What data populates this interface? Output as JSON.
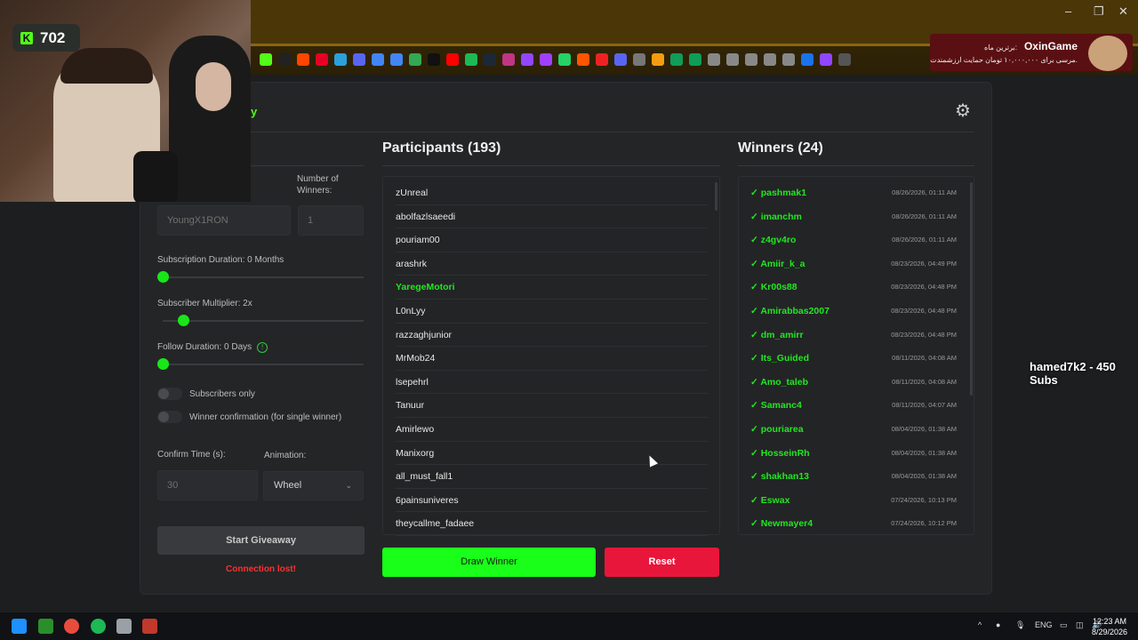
{
  "browser": {
    "bookmark_icons": [
      "kick-icon",
      "x-icon",
      "reddit-icon",
      "pinterest-icon",
      "telegram-icon",
      "download-icon",
      "translate-icon",
      "docs-icon",
      "image-icon",
      "film-icon",
      "youtube-icon",
      "spotify-icon",
      "steam-icon",
      "instagram-icon",
      "twitch-icon",
      "r-icon",
      "whatsapp-icon",
      "music-icon",
      "red-icon",
      "discord-icon",
      "controller-icon",
      "orange-icon",
      "plus-icon",
      "sheet-icon",
      "globe-icon",
      "link-icon",
      "flask-icon",
      "lock-icon",
      "moon-icon",
      "mail-icon",
      "purple-icon",
      "play-icon"
    ],
    "ad": {
      "name": "OxinGame",
      "line1": "برترین ماه:",
      "line2": "مرسی برای ۱۰,۰۰۰,۰۰۰ تومان حمایت ارزشمندت."
    }
  },
  "webcam": {
    "follower_count": "702"
  },
  "app": {
    "title_fragment": "y",
    "settings_icon": "gear-icon",
    "left": {
      "number_of_winners_label": "Number of Winners:",
      "keyword_placeholder": "YoungX1RON",
      "winners_placeholder": "1",
      "subscription_duration_label": "Subscription Duration: 0 Months",
      "subscription_duration_value": 0,
      "subscriber_multiplier_label": "Subscriber Multiplier: 2x",
      "subscriber_multiplier_value": 0.11,
      "follow_duration_label": "Follow Duration:  0  Days",
      "follow_duration_value": 0,
      "subscribers_only_label": "Subscribers only",
      "winner_confirmation_label": "Winner confirmation (for single winner)",
      "confirm_time_label": "Confirm Time (s):",
      "confirm_time_placeholder": "30",
      "animation_label": "Animation:",
      "animation_value": "Wheel",
      "start_button": "Start Giveaway",
      "connection_status": "Connection lost!"
    },
    "participants": {
      "heading": "Participants (193)",
      "items": [
        "zUnreal",
        "abolfazlsaeedi",
        "pouriam00",
        "arashrk",
        "YaregeMotori",
        "L0nLyy",
        "razzaghjunior",
        "MrMob24",
        "lsepehrl",
        "Tanuur",
        "Amirlewo",
        "Manixorg",
        "all_must_fall1",
        "6painsuniveres",
        "theycallme_fadaee"
      ],
      "highlighted_index": 4
    },
    "winners": {
      "heading": "Winners (24)",
      "items": [
        {
          "name": "pashmak1",
          "date": "08/26/2026, 01:11 AM"
        },
        {
          "name": "imanchm",
          "date": "08/26/2026, 01:11 AM"
        },
        {
          "name": "z4gv4ro",
          "date": "08/26/2026, 01:11 AM"
        },
        {
          "name": "Amiir_k_a",
          "date": "08/23/2026, 04:49 PM"
        },
        {
          "name": "Kr00s88",
          "date": "08/23/2026, 04:48 PM"
        },
        {
          "name": "Amirabbas2007",
          "date": "08/23/2026, 04:48 PM"
        },
        {
          "name": "dm_amirr",
          "date": "08/23/2026, 04:48 PM"
        },
        {
          "name": "Its_Guided",
          "date": "08/11/2026, 04:08 AM"
        },
        {
          "name": "Amo_taleb",
          "date": "08/11/2026, 04:08 AM"
        },
        {
          "name": "Samanc4",
          "date": "08/11/2026, 04:07 AM"
        },
        {
          "name": "pouriarea",
          "date": "08/04/2026, 01:38 AM"
        },
        {
          "name": "HosseinRh",
          "date": "08/04/2026, 01:38 AM"
        },
        {
          "name": "shakhan13",
          "date": "08/04/2026, 01:38 AM"
        },
        {
          "name": "Eswax",
          "date": "07/24/2026, 10:13 PM"
        },
        {
          "name": "Newmayer4",
          "date": "07/24/2026, 10:12 PM"
        }
      ]
    },
    "draw_button": "Draw Winner",
    "reset_button": "Reset"
  },
  "stream_overlay": {
    "text": "hamed7k2 - 450 Subs"
  },
  "taskbar": {
    "language": "ENG",
    "time": "12:23 AM",
    "date": "8/29/2026"
  },
  "colors": {
    "accent_green": "#19ff19",
    "reset_red": "#e8163a",
    "error_red": "#ff3030"
  }
}
